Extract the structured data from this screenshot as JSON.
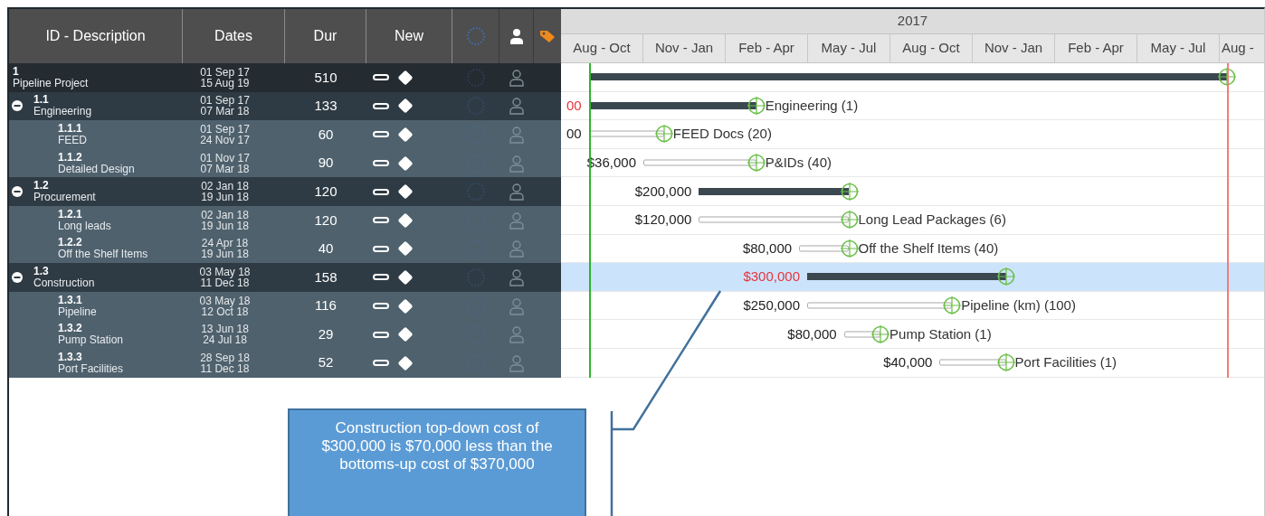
{
  "table": {
    "columns": [
      "ID - Description",
      "Dates",
      "Dur",
      "New"
    ],
    "rows": [
      {
        "kind": "project",
        "id": "1",
        "description": "Pipeline Project",
        "start": "01 Sep 17",
        "finish": "15 Aug 19",
        "duration": "510",
        "selected": false,
        "children": [
          {
            "kind": "summary",
            "id": "1.1",
            "description": "Engineering",
            "start": "01 Sep 17",
            "finish": "07 Mar 18",
            "duration": "133",
            "expanded": true,
            "selected": false,
            "cost": "00",
            "over_budget": true,
            "bar_label": "Engineering (1)",
            "children": [
              {
                "kind": "task",
                "id": "1.1.1",
                "description": "FEED",
                "start": "01 Sep 17",
                "finish": "24 Nov 17",
                "duration": "60",
                "selected": false,
                "cost": "00",
                "over_budget": false,
                "bar_label": "FEED Docs (20)"
              },
              {
                "kind": "task",
                "id": "1.1.2",
                "description": "Detailed Design",
                "start": "01 Nov 17",
                "finish": "07 Mar 18",
                "duration": "90",
                "selected": false,
                "cost": "$36,000",
                "over_budget": false,
                "bar_label": "P&IDs (40)"
              }
            ]
          },
          {
            "kind": "summary",
            "id": "1.2",
            "description": "Procurement",
            "start": "02 Jan 18",
            "finish": "19 Jun 18",
            "duration": "120",
            "expanded": true,
            "selected": false,
            "cost": "$200,000",
            "over_budget": false,
            "children": [
              {
                "kind": "task",
                "id": "1.2.1",
                "description": "Long leads",
                "start": "02 Jan 18",
                "finish": "19 Jun 18",
                "duration": "120",
                "selected": false,
                "cost": "$120,000",
                "over_budget": false,
                "bar_label": "Long Lead Packages (6)"
              },
              {
                "kind": "task",
                "id": "1.2.2",
                "description": "Off the Shelf Items",
                "start": "24 Apr 18",
                "finish": "19 Jun 18",
                "duration": "40",
                "selected": false,
                "cost": "$80,000",
                "over_budget": false,
                "bar_label": "Off the Shelf Items (40)"
              }
            ]
          },
          {
            "kind": "summary",
            "id": "1.3",
            "description": "Construction",
            "start": "03 May 18",
            "finish": "11 Dec 18",
            "duration": "158",
            "expanded": true,
            "selected": true,
            "cost": "$300,000",
            "over_budget": true,
            "children": [
              {
                "kind": "task",
                "id": "1.3.1",
                "description": "Pipeline",
                "start": "03 May 18",
                "finish": "12 Oct 18",
                "duration": "116",
                "selected": false,
                "cost": "$250,000",
                "over_budget": false,
                "bar_label": "Pipeline (km) (100)"
              },
              {
                "kind": "task",
                "id": "1.3.2",
                "description": "Pump Station",
                "start": "13 Jun 18",
                "finish": "24 Jul 18",
                "duration": "29",
                "selected": false,
                "cost": "$80,000",
                "over_budget": false,
                "bar_label": "Pump Station (1)"
              },
              {
                "kind": "task",
                "id": "1.3.3",
                "description": "Port Facilities",
                "start": "28 Sep 18",
                "finish": "11 Dec 18",
                "duration": "52",
                "selected": false,
                "cost": "$40,000",
                "over_budget": false,
                "bar_label": "Port Facilities (1)"
              }
            ]
          }
        ]
      }
    ]
  },
  "timeline": {
    "year": "2017",
    "quarters": [
      "Aug - Oct",
      "Nov - Jan",
      "Feb - Apr",
      "May - Jul",
      "Aug - Oct",
      "Nov - Jan",
      "Feb - Apr",
      "May - Jul",
      "Aug -"
    ]
  },
  "callout": {
    "text": "Construction top-down cost of $300,000 is $70,000 less than the bottoms-up cost of $370,000"
  }
}
